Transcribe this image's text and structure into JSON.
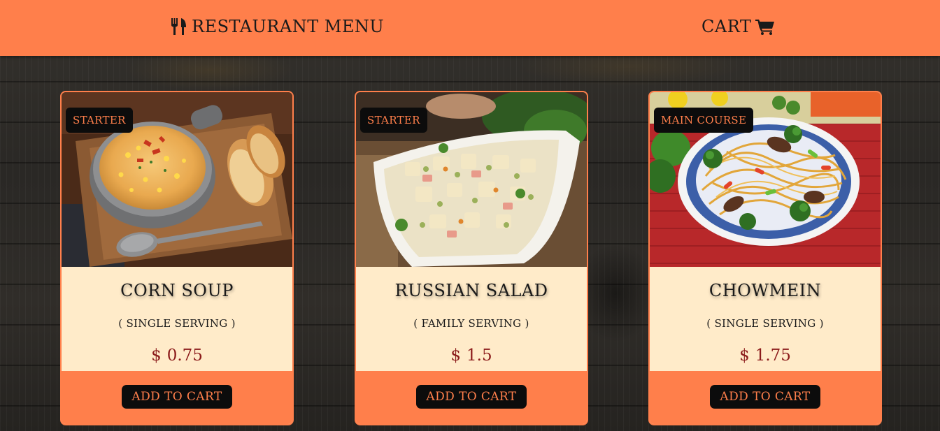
{
  "header": {
    "brand_label": "RESTAURANT MENU",
    "brand_icon": "fork-knife-icon",
    "cart_label": "CART",
    "cart_icon": "shopping-cart-icon",
    "background_color": "#ff7f4b"
  },
  "menu": {
    "items": [
      {
        "category": "STARTER",
        "name": "CORN SOUP",
        "serving": "( SINGLE SERVING )",
        "currency": "$",
        "price": "0.75",
        "button_label": "ADD TO CART"
      },
      {
        "category": "STARTER",
        "name": "RUSSIAN SALAD",
        "serving": "( FAMILY SERVING )",
        "currency": "$",
        "price": "1.5",
        "button_label": "ADD TO CART"
      },
      {
        "category": "MAIN COURSE",
        "name": "CHOWMEIN",
        "serving": "( SINGLE SERVING )",
        "currency": "$",
        "price": "1.75",
        "button_label": "ADD TO CART"
      }
    ]
  },
  "colors": {
    "accent": "#ff7f4b",
    "card_body": "#ffebc9",
    "price": "#8b1a1a",
    "badge_bg": "#0c0c0c"
  }
}
